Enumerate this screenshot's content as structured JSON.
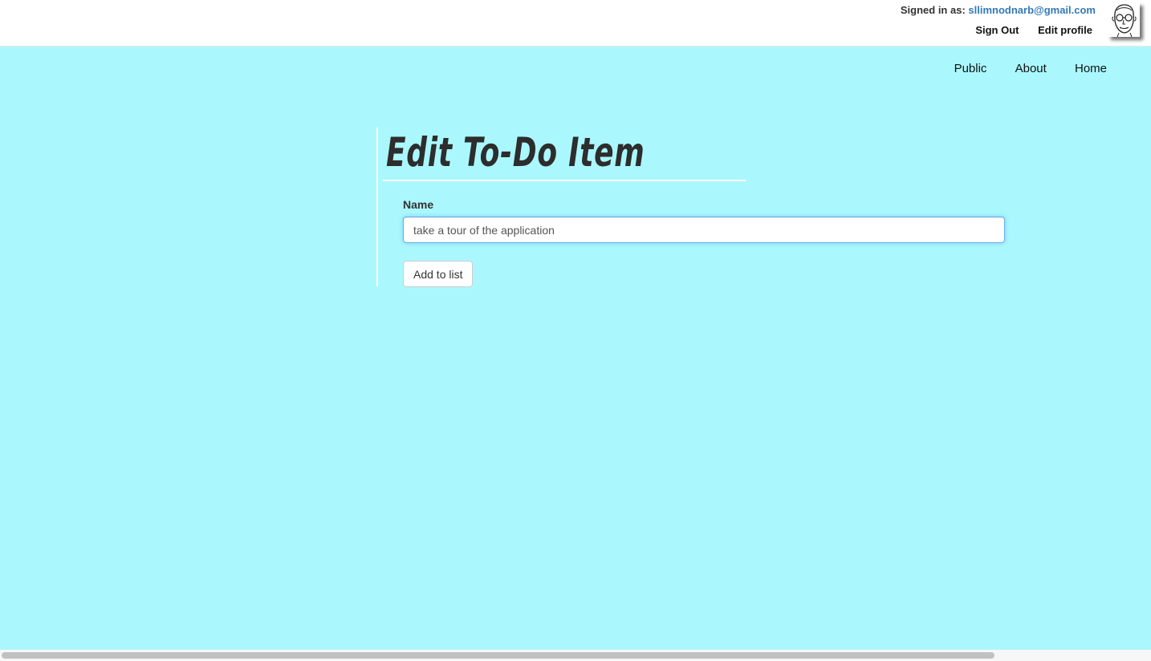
{
  "account": {
    "signed_in_label": "Signed in as:",
    "email": "sllimnodnarb@gmail.com",
    "sign_out": "Sign Out",
    "edit_profile": "Edit profile",
    "avatar_icon": "user-portrait-sketch-icon"
  },
  "nav": {
    "items": [
      {
        "label": "Public"
      },
      {
        "label": "About"
      },
      {
        "label": "Home"
      }
    ]
  },
  "page": {
    "title": "Edit To-Do Item"
  },
  "form": {
    "name_label": "Name",
    "name_value": "take a tour of the application",
    "submit_label": "Add to list"
  },
  "colors": {
    "background": "#aaf8fe",
    "link": "#337ab7",
    "input_focus": "#66afe9"
  }
}
